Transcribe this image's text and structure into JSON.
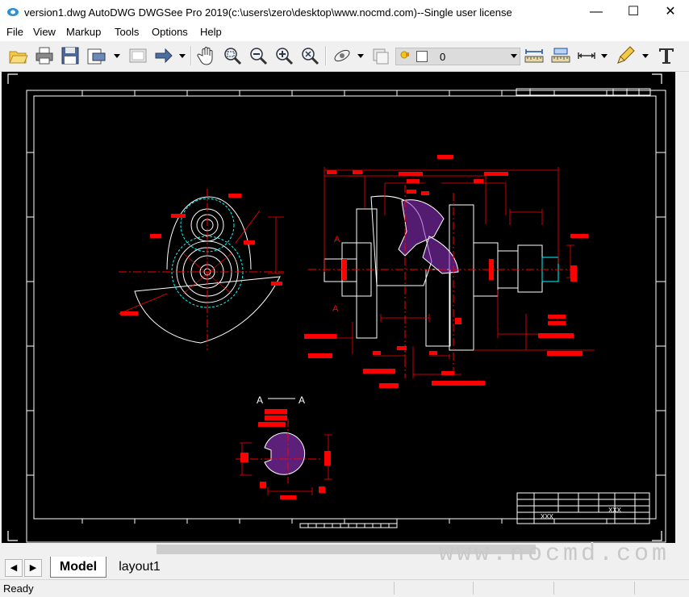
{
  "window": {
    "title": "version1.dwg AutoDWG DWGSee Pro 2019(c:\\users\\zero\\desktop\\www.nocmd.com)--Single user license",
    "minimize_glyph": "—",
    "maximize_glyph": "☐",
    "close_glyph": "✕"
  },
  "menu": {
    "items": [
      "File",
      "View",
      "Markup",
      "Tools",
      "Options",
      "Help"
    ]
  },
  "toolbar": {
    "icons": [
      "open-folder-icon",
      "print-icon",
      "save-icon",
      "print-preview-icon",
      "dropdown-arrow-icon",
      "blank-page-icon",
      "forward-arrow-icon",
      "dropdown-arrow-icon",
      "pan-hand-icon",
      "zoom-window-icon",
      "zoom-out-icon",
      "zoom-in-icon",
      "zoom-extents-icon",
      "orbit-icon",
      "dropdown-arrow-icon",
      "layer-state-icon",
      "layer-icon",
      "measure-icon",
      "measure-area-icon",
      "dimension-icon",
      "dropdown-arrow-icon",
      "pen-markup-icon",
      "dropdown-arrow-icon",
      "text-icon"
    ],
    "layer_value": "0"
  },
  "drawing": {
    "section_label": "A — A",
    "section_letter_left": "A",
    "section_letter_right": "A",
    "cut_label_top": "A",
    "cut_label_bottom": "A",
    "titleblock_name_1": "XXX",
    "titleblock_name_2": "XXX",
    "colors": {
      "background": "#000000",
      "border": "#ffffff",
      "geometry": "#ffffff",
      "dimension": "#ff0000",
      "hatch": "#9933cc",
      "center": "#ff0000",
      "hidden": "#00ffff"
    }
  },
  "tabs": {
    "prev_glyph": "◀",
    "next_glyph": "▶",
    "items": [
      "Model",
      "layout1"
    ],
    "active": "Model"
  },
  "status": {
    "text": "Ready"
  },
  "watermark": "www.nocmd.com"
}
